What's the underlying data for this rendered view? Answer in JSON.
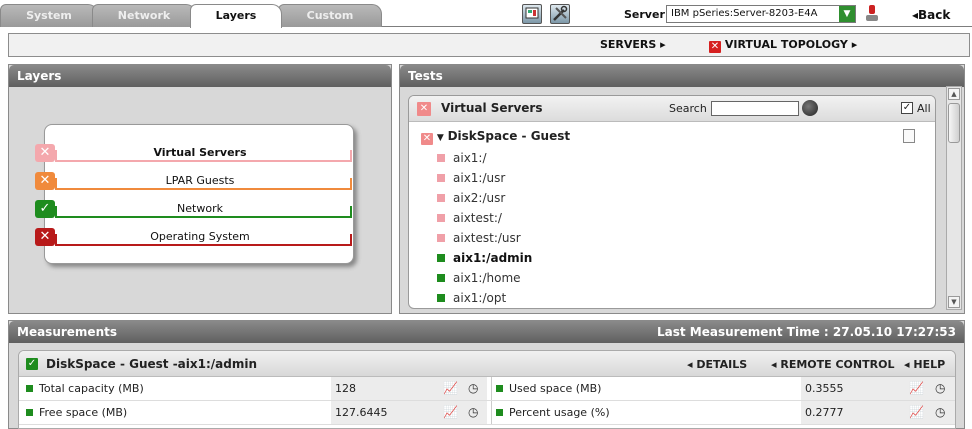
{
  "tabs": [
    {
      "label": "System"
    },
    {
      "label": "Network"
    },
    {
      "label": "Layers"
    },
    {
      "label": "Custom"
    }
  ],
  "header": {
    "server_label": "Server",
    "server_value": "IBM pSeries:Server-8203-E4A",
    "back_label": "Back"
  },
  "breadcrumb": {
    "servers": "SERVERS",
    "virtual_topology": "VIRTUAL TOPOLOGY"
  },
  "layers_panel": {
    "title": "Layers",
    "items": [
      {
        "label": "Virtual Servers",
        "status": "error-light",
        "color": "#f4a8ad"
      },
      {
        "label": "LPAR Guests",
        "status": "warning",
        "color": "#f08a3c"
      },
      {
        "label": "Network",
        "status": "ok",
        "color": "#1e8c1e"
      },
      {
        "label": "Operating System",
        "status": "error",
        "color": "#b81a1a"
      }
    ]
  },
  "tests_panel": {
    "title": "Tests",
    "header_title": "Virtual Servers",
    "search_label": "Search",
    "search_value": "",
    "all_label": "All",
    "group": "DiskSpace - Guest",
    "items": [
      {
        "label": "aix1:/",
        "status_color": "#f0a0a8",
        "bold": false
      },
      {
        "label": "aix1:/usr",
        "status_color": "#f0a0a8",
        "bold": false
      },
      {
        "label": "aix2:/usr",
        "status_color": "#f0a0a8",
        "bold": false
      },
      {
        "label": "aixtest:/",
        "status_color": "#f0a0a8",
        "bold": false
      },
      {
        "label": "aixtest:/usr",
        "status_color": "#f0a0a8",
        "bold": false
      },
      {
        "label": "aix1:/admin",
        "status_color": "#1e8c1e",
        "bold": true
      },
      {
        "label": "aix1:/home",
        "status_color": "#1e8c1e",
        "bold": false
      },
      {
        "label": "aix1:/opt",
        "status_color": "#1e8c1e",
        "bold": false
      }
    ]
  },
  "measurements": {
    "title": "Measurements",
    "last_time": "Last Measurement Time : 27.05.10 17:27:53",
    "card_title": "DiskSpace - Guest -aix1:/admin",
    "details": "DETAILS",
    "remote_control": "REMOTE CONTROL",
    "help": "HELP",
    "rows": [
      {
        "left_label": "Total capacity (MB)",
        "left_value": "128",
        "right_label": "Used space (MB)",
        "right_value": "0.3555"
      },
      {
        "left_label": "Free space (MB)",
        "left_value": "127.6445",
        "right_label": "Percent usage (%)",
        "right_value": "0.2777"
      }
    ]
  }
}
